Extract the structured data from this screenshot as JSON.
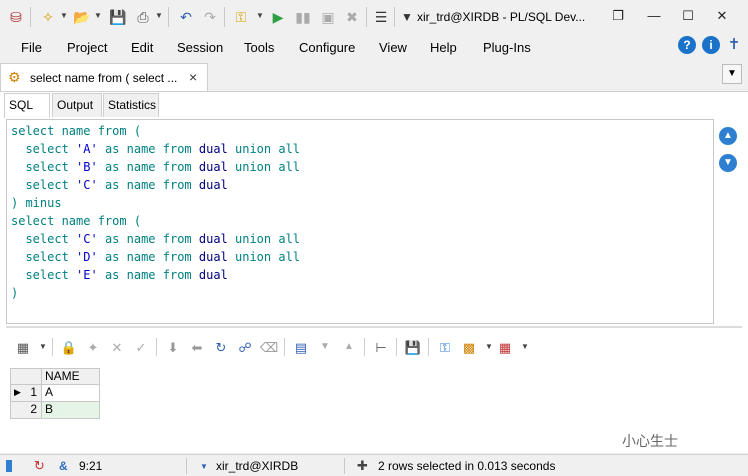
{
  "window": {
    "title": "xir_trd@XIRDB - PL/SQL Dev...",
    "controls": {
      "restore": "❐",
      "minimize": "—",
      "maximize": "☐",
      "close": "✕"
    }
  },
  "menu": [
    "File",
    "Project",
    "Edit",
    "Session",
    "Tools",
    "Configure",
    "View",
    "Help",
    "Plug-Ins"
  ],
  "doc_tab": {
    "label": "select name from ( select ...",
    "close": "×"
  },
  "sub_tabs": [
    "SQL",
    "Output",
    "Statistics"
  ],
  "editor": {
    "lines": [
      [
        {
          "t": "select name from (",
          "c": "kw"
        }
      ],
      [
        {
          "t": "  select ",
          "c": "kw"
        },
        {
          "t": "'A'",
          "c": "str"
        },
        {
          "t": " as name from ",
          "c": "kw"
        },
        {
          "t": "dual",
          "c": "tx"
        },
        {
          "t": " union all",
          "c": "kw"
        }
      ],
      [
        {
          "t": "  select ",
          "c": "kw"
        },
        {
          "t": "'B'",
          "c": "str"
        },
        {
          "t": " as name from ",
          "c": "kw"
        },
        {
          "t": "dual",
          "c": "tx"
        },
        {
          "t": " union all",
          "c": "kw"
        }
      ],
      [
        {
          "t": "  select ",
          "c": "kw"
        },
        {
          "t": "'C'",
          "c": "str"
        },
        {
          "t": " as name from ",
          "c": "kw"
        },
        {
          "t": "dual",
          "c": "tx"
        }
      ],
      [
        {
          "t": ") minus",
          "c": "kw"
        }
      ],
      [
        {
          "t": "select name from (",
          "c": "kw"
        }
      ],
      [
        {
          "t": "  select ",
          "c": "kw"
        },
        {
          "t": "'C'",
          "c": "str"
        },
        {
          "t": " as name from ",
          "c": "kw"
        },
        {
          "t": "dual",
          "c": "tx"
        },
        {
          "t": " union all",
          "c": "kw"
        }
      ],
      [
        {
          "t": "  select ",
          "c": "kw"
        },
        {
          "t": "'D'",
          "c": "str"
        },
        {
          "t": " as name from ",
          "c": "kw"
        },
        {
          "t": "dual",
          "c": "tx"
        },
        {
          "t": " union all",
          "c": "kw"
        }
      ],
      [
        {
          "t": "  select ",
          "c": "kw"
        },
        {
          "t": "'E'",
          "c": "str"
        },
        {
          "t": " as name from ",
          "c": "kw"
        },
        {
          "t": "dual",
          "c": "tx"
        }
      ],
      [
        {
          "t": ")",
          "c": "kw"
        }
      ]
    ]
  },
  "grid": {
    "columns": [
      "NAME"
    ],
    "rows": [
      {
        "num": "1",
        "values": [
          "A"
        ]
      },
      {
        "num": "2",
        "values": [
          "B"
        ]
      }
    ]
  },
  "status": {
    "position": "9:21",
    "connection": "xir_trd@XIRDB",
    "message": "2 rows selected in 0.013 seconds",
    "amp": "&"
  },
  "watermark": "小心生士",
  "colors": {
    "keyword": "#008080",
    "string": "#0000c8",
    "table": "#000080",
    "accent": "#1a73c9"
  }
}
